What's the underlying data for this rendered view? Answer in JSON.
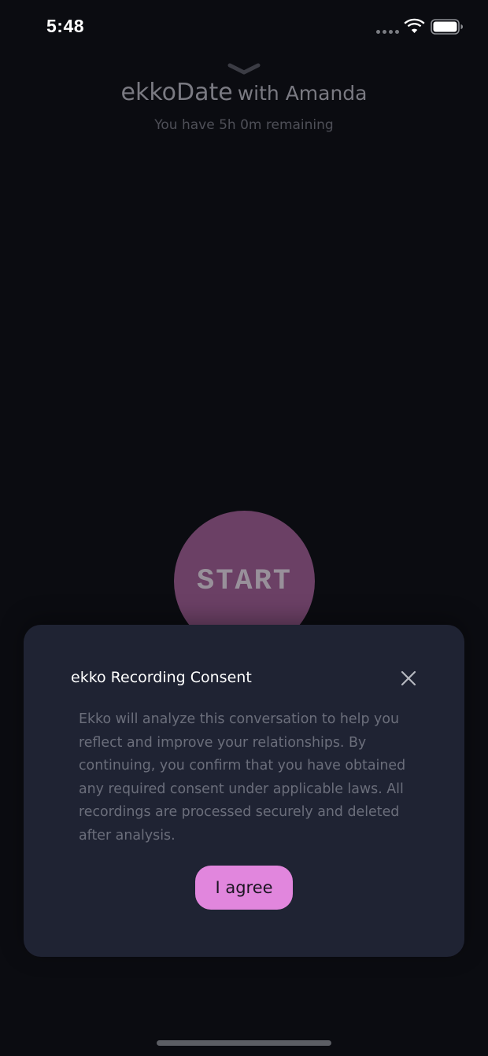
{
  "status_bar": {
    "time": "5:48"
  },
  "header": {
    "app_name": "ekkoDate",
    "with_text": "with Amanda",
    "remaining_text": "You have 5h 0m remaining"
  },
  "start_button": {
    "label": "START",
    "color": "#6b4065"
  },
  "consent_modal": {
    "title": "ekko Recording Consent",
    "body": "Ekko will analyze this conversation to help you reflect and improve your relationships. By continuing, you confirm that you have obtained any required consent under applicable laws. All recordings are processed securely and deleted after analysis.",
    "agree_label": "I agree",
    "accent_color": "#e186dd",
    "background_color": "#1f2333"
  },
  "icons": {
    "collapse": "chevron-down-icon",
    "close": "close-icon",
    "wifi": "wifi-icon",
    "battery": "battery-icon",
    "signal": "cellular-signal-icon"
  }
}
